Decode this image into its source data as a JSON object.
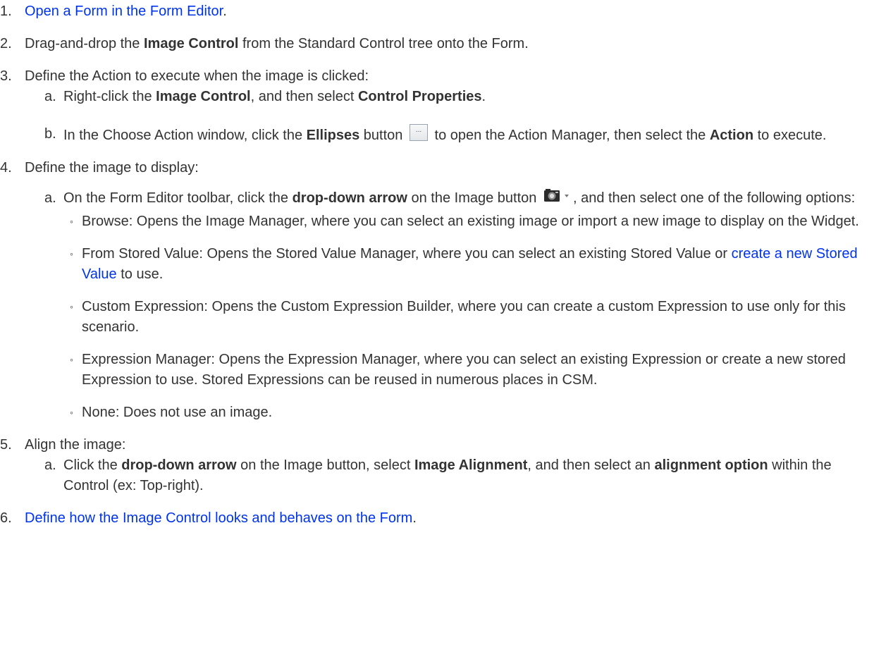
{
  "steps": [
    {
      "num": "1.",
      "link": "Open a Form in the Form Editor",
      "after": "."
    },
    {
      "num": "2.",
      "t1": "Drag-and-drop the ",
      "b1": "Image Control",
      "t2": " from the Standard Control tree onto the Form."
    },
    {
      "num": "3.",
      "text": "Define the Action to execute when the image is clicked:",
      "a": {
        "label": "a.",
        "t1": "Right-click the ",
        "b1": "Image Control",
        "t2": ", and then select ",
        "b2": "Control Properties",
        "t3": "."
      },
      "b": {
        "label": "b.",
        "t1": "In the Choose Action window, click the ",
        "b1": "Ellipses",
        "t2": " button ",
        "t3": " to open the Action Manager, then select the ",
        "b2": "Action",
        "t4": " to execute."
      }
    },
    {
      "num": "4.",
      "text": "Define the image to display:",
      "a": {
        "label": "a.",
        "t1": "On the Form Editor toolbar, click the ",
        "b1": "drop-down arrow",
        "t2": " on the Image button ",
        "t3": ", and then select one of the following options:",
        "options": [
          {
            "text": "Browse: Opens the Image Manager, where you can select an existing image or import a new image to display on the Widget."
          },
          {
            "t1": "From Stored Value: Opens the Stored Value Manager, where you can select an existing Stored Value or ",
            "link": "create a new Stored Value",
            "t2": " to use."
          },
          {
            "text": "Custom Expression: Opens the Custom Expression Builder, where you can create a custom Expression to use only for this scenario."
          },
          {
            "text": "Expression Manager: Opens the Expression Manager, where you can select an existing Expression or create a new stored Expression to use. Stored Expressions can be reused in numerous places in CSM."
          },
          {
            "text": "None: Does not use an image."
          }
        ]
      }
    },
    {
      "num": "5.",
      "text": "Align the image:",
      "a": {
        "label": "a.",
        "t1": "Click the ",
        "b1": "drop-down arrow",
        "t2": " on the Image button, select ",
        "b2": "Image Alignment",
        "t3": ", and then select an ",
        "b3": "alignment option",
        "t4": " within the Control (ex: Top-right)."
      }
    },
    {
      "num": "6.",
      "link": "Define how the Image Control looks and behaves on the Form",
      "after": "."
    }
  ],
  "bullet_char": "◦",
  "icons": {
    "ellipses_button": "ellipses-button-icon",
    "image_button": "camera-icon",
    "dropdown_arrow": "dropdown-arrow-icon",
    "ellipses_glyph": "..."
  },
  "colors": {
    "link": "#0033ee",
    "text": "#333333"
  }
}
